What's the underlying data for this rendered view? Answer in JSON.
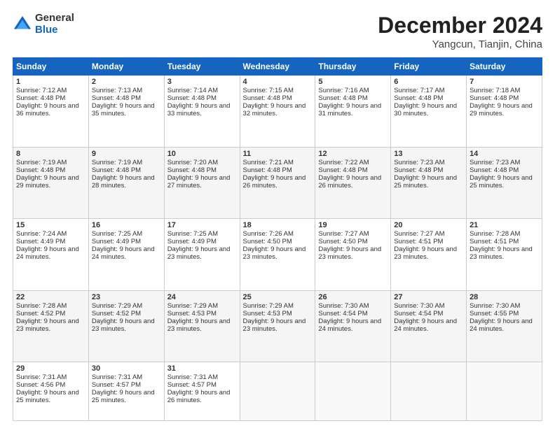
{
  "logo": {
    "general": "General",
    "blue": "Blue"
  },
  "header": {
    "month": "December 2024",
    "location": "Yangcun, Tianjin, China"
  },
  "weekdays": [
    "Sunday",
    "Monday",
    "Tuesday",
    "Wednesday",
    "Thursday",
    "Friday",
    "Saturday"
  ],
  "weeks": [
    [
      {
        "day": "1",
        "sunrise": "Sunrise: 7:12 AM",
        "sunset": "Sunset: 4:48 PM",
        "daylight": "Daylight: 9 hours and 36 minutes."
      },
      {
        "day": "2",
        "sunrise": "Sunrise: 7:13 AM",
        "sunset": "Sunset: 4:48 PM",
        "daylight": "Daylight: 9 hours and 35 minutes."
      },
      {
        "day": "3",
        "sunrise": "Sunrise: 7:14 AM",
        "sunset": "Sunset: 4:48 PM",
        "daylight": "Daylight: 9 hours and 33 minutes."
      },
      {
        "day": "4",
        "sunrise": "Sunrise: 7:15 AM",
        "sunset": "Sunset: 4:48 PM",
        "daylight": "Daylight: 9 hours and 32 minutes."
      },
      {
        "day": "5",
        "sunrise": "Sunrise: 7:16 AM",
        "sunset": "Sunset: 4:48 PM",
        "daylight": "Daylight: 9 hours and 31 minutes."
      },
      {
        "day": "6",
        "sunrise": "Sunrise: 7:17 AM",
        "sunset": "Sunset: 4:48 PM",
        "daylight": "Daylight: 9 hours and 30 minutes."
      },
      {
        "day": "7",
        "sunrise": "Sunrise: 7:18 AM",
        "sunset": "Sunset: 4:48 PM",
        "daylight": "Daylight: 9 hours and 29 minutes."
      }
    ],
    [
      {
        "day": "8",
        "sunrise": "Sunrise: 7:19 AM",
        "sunset": "Sunset: 4:48 PM",
        "daylight": "Daylight: 9 hours and 29 minutes."
      },
      {
        "day": "9",
        "sunrise": "Sunrise: 7:19 AM",
        "sunset": "Sunset: 4:48 PM",
        "daylight": "Daylight: 9 hours and 28 minutes."
      },
      {
        "day": "10",
        "sunrise": "Sunrise: 7:20 AM",
        "sunset": "Sunset: 4:48 PM",
        "daylight": "Daylight: 9 hours and 27 minutes."
      },
      {
        "day": "11",
        "sunrise": "Sunrise: 7:21 AM",
        "sunset": "Sunset: 4:48 PM",
        "daylight": "Daylight: 9 hours and 26 minutes."
      },
      {
        "day": "12",
        "sunrise": "Sunrise: 7:22 AM",
        "sunset": "Sunset: 4:48 PM",
        "daylight": "Daylight: 9 hours and 26 minutes."
      },
      {
        "day": "13",
        "sunrise": "Sunrise: 7:23 AM",
        "sunset": "Sunset: 4:48 PM",
        "daylight": "Daylight: 9 hours and 25 minutes."
      },
      {
        "day": "14",
        "sunrise": "Sunrise: 7:23 AM",
        "sunset": "Sunset: 4:48 PM",
        "daylight": "Daylight: 9 hours and 25 minutes."
      }
    ],
    [
      {
        "day": "15",
        "sunrise": "Sunrise: 7:24 AM",
        "sunset": "Sunset: 4:49 PM",
        "daylight": "Daylight: 9 hours and 24 minutes."
      },
      {
        "day": "16",
        "sunrise": "Sunrise: 7:25 AM",
        "sunset": "Sunset: 4:49 PM",
        "daylight": "Daylight: 9 hours and 24 minutes."
      },
      {
        "day": "17",
        "sunrise": "Sunrise: 7:25 AM",
        "sunset": "Sunset: 4:49 PM",
        "daylight": "Daylight: 9 hours and 23 minutes."
      },
      {
        "day": "18",
        "sunrise": "Sunrise: 7:26 AM",
        "sunset": "Sunset: 4:50 PM",
        "daylight": "Daylight: 9 hours and 23 minutes."
      },
      {
        "day": "19",
        "sunrise": "Sunrise: 7:27 AM",
        "sunset": "Sunset: 4:50 PM",
        "daylight": "Daylight: 9 hours and 23 minutes."
      },
      {
        "day": "20",
        "sunrise": "Sunrise: 7:27 AM",
        "sunset": "Sunset: 4:51 PM",
        "daylight": "Daylight: 9 hours and 23 minutes."
      },
      {
        "day": "21",
        "sunrise": "Sunrise: 7:28 AM",
        "sunset": "Sunset: 4:51 PM",
        "daylight": "Daylight: 9 hours and 23 minutes."
      }
    ],
    [
      {
        "day": "22",
        "sunrise": "Sunrise: 7:28 AM",
        "sunset": "Sunset: 4:52 PM",
        "daylight": "Daylight: 9 hours and 23 minutes."
      },
      {
        "day": "23",
        "sunrise": "Sunrise: 7:29 AM",
        "sunset": "Sunset: 4:52 PM",
        "daylight": "Daylight: 9 hours and 23 minutes."
      },
      {
        "day": "24",
        "sunrise": "Sunrise: 7:29 AM",
        "sunset": "Sunset: 4:53 PM",
        "daylight": "Daylight: 9 hours and 23 minutes."
      },
      {
        "day": "25",
        "sunrise": "Sunrise: 7:29 AM",
        "sunset": "Sunset: 4:53 PM",
        "daylight": "Daylight: 9 hours and 23 minutes."
      },
      {
        "day": "26",
        "sunrise": "Sunrise: 7:30 AM",
        "sunset": "Sunset: 4:54 PM",
        "daylight": "Daylight: 9 hours and 24 minutes."
      },
      {
        "day": "27",
        "sunrise": "Sunrise: 7:30 AM",
        "sunset": "Sunset: 4:54 PM",
        "daylight": "Daylight: 9 hours and 24 minutes."
      },
      {
        "day": "28",
        "sunrise": "Sunrise: 7:30 AM",
        "sunset": "Sunset: 4:55 PM",
        "daylight": "Daylight: 9 hours and 24 minutes."
      }
    ],
    [
      {
        "day": "29",
        "sunrise": "Sunrise: 7:31 AM",
        "sunset": "Sunset: 4:56 PM",
        "daylight": "Daylight: 9 hours and 25 minutes."
      },
      {
        "day": "30",
        "sunrise": "Sunrise: 7:31 AM",
        "sunset": "Sunset: 4:57 PM",
        "daylight": "Daylight: 9 hours and 25 minutes."
      },
      {
        "day": "31",
        "sunrise": "Sunrise: 7:31 AM",
        "sunset": "Sunset: 4:57 PM",
        "daylight": "Daylight: 9 hours and 26 minutes."
      },
      null,
      null,
      null,
      null
    ]
  ]
}
